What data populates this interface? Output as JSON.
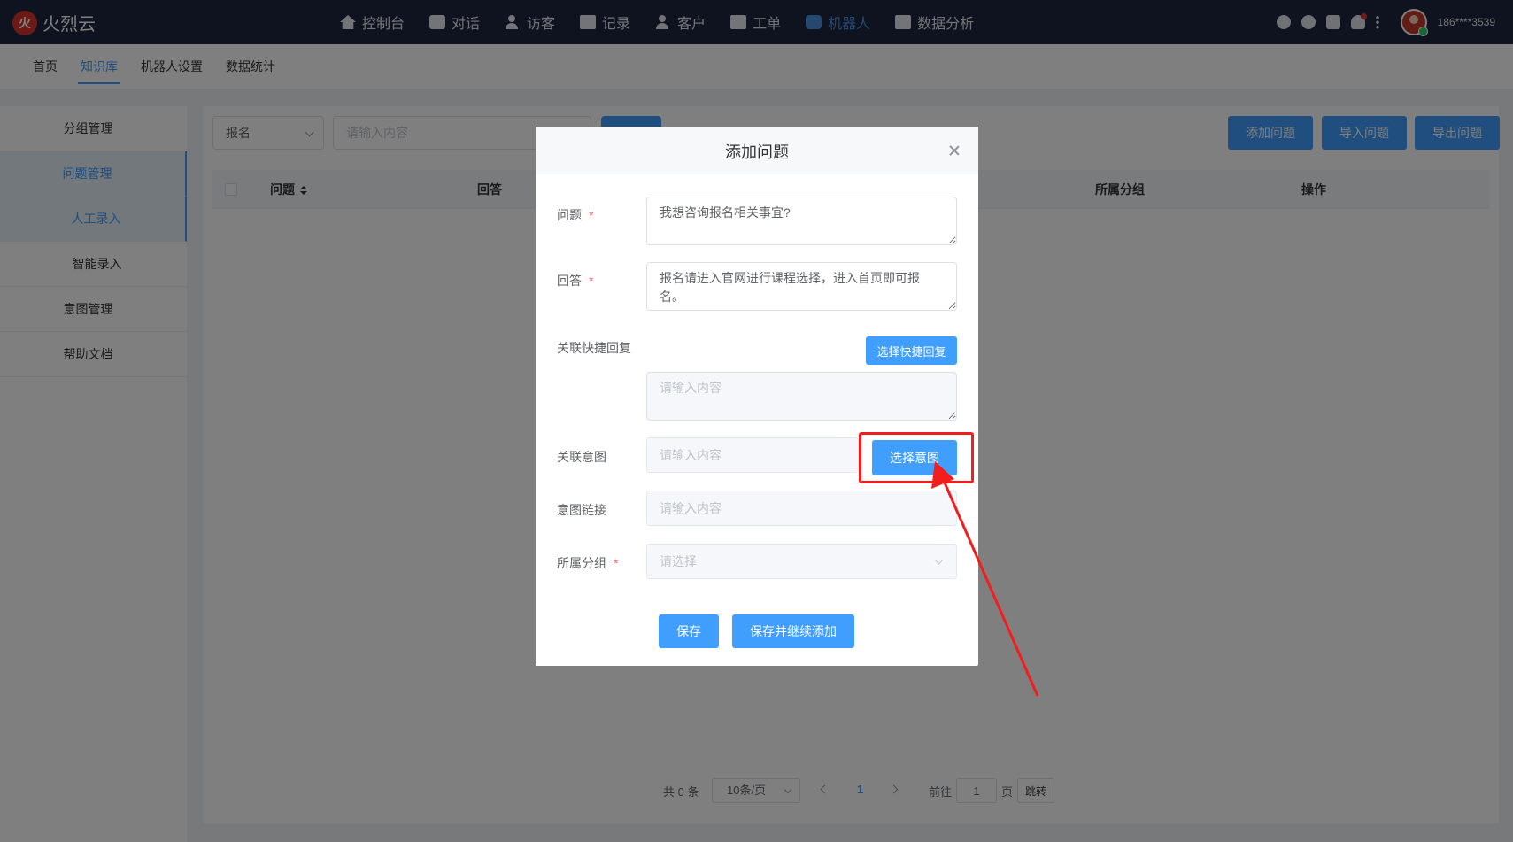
{
  "app": {
    "logo_text": "火烈云"
  },
  "topnav": [
    {
      "label": "控制台",
      "icon": "home-icon"
    },
    {
      "label": "对话",
      "icon": "chat-icon"
    },
    {
      "label": "访客",
      "icon": "visitor-icon"
    },
    {
      "label": "记录",
      "icon": "record-icon"
    },
    {
      "label": "客户",
      "icon": "customer-icon"
    },
    {
      "label": "工单",
      "icon": "ticket-icon"
    },
    {
      "label": "机器人",
      "icon": "robot-icon",
      "active": true
    },
    {
      "label": "数据分析",
      "icon": "chart-icon"
    }
  ],
  "user": {
    "name": "186****3539"
  },
  "subnav": [
    {
      "label": "首页"
    },
    {
      "label": "知识库",
      "active": true
    },
    {
      "label": "机器人设置"
    },
    {
      "label": "数据统计"
    }
  ],
  "sidebar": [
    {
      "label": "分组管理"
    },
    {
      "label": "问题管理",
      "active": true
    },
    {
      "label": "人工录入",
      "active": true,
      "sub": true
    },
    {
      "label": "智能录入",
      "sub": true
    },
    {
      "label": "意图管理"
    },
    {
      "label": "帮助文档"
    }
  ],
  "filter": {
    "select_value": "报名",
    "placeholder": "请输入内容"
  },
  "actions": {
    "add": "添加问题",
    "import": "导入问题",
    "export": "导出问题"
  },
  "table": {
    "headers": {
      "question": "问题",
      "answer": "回答",
      "group": "所属分组",
      "ops": "操作"
    }
  },
  "pager": {
    "total": "共 0 条",
    "size": "10条/页",
    "current": "1",
    "goto": "前往",
    "goto_value": "1",
    "page_unit": "页",
    "jump": "跳转"
  },
  "dialog": {
    "title": "添加问题",
    "question_label": "问题",
    "question_value": "我想咨询报名相关事宜?",
    "answer_label": "回答",
    "answer_value": "报名请进入官网进行课程选择，进入首页即可报名。",
    "quick_reply_label": "关联快捷回复",
    "quick_reply_btn": "选择快捷回复",
    "quick_reply_placeholder": "请输入内容",
    "intent_label": "关联意图",
    "intent_placeholder": "请输入内容",
    "intent_btn": "选择意图",
    "intent_link_label": "意图链接",
    "intent_link_placeholder": "请输入内容",
    "group_label": "所属分组",
    "group_placeholder": "请选择",
    "required_mark": "*",
    "save": "保存",
    "save_continue": "保存并继续添加"
  },
  "colors": {
    "primary": "#409eff",
    "topbar": "#1f2740",
    "highlight": "#f21d1d"
  }
}
